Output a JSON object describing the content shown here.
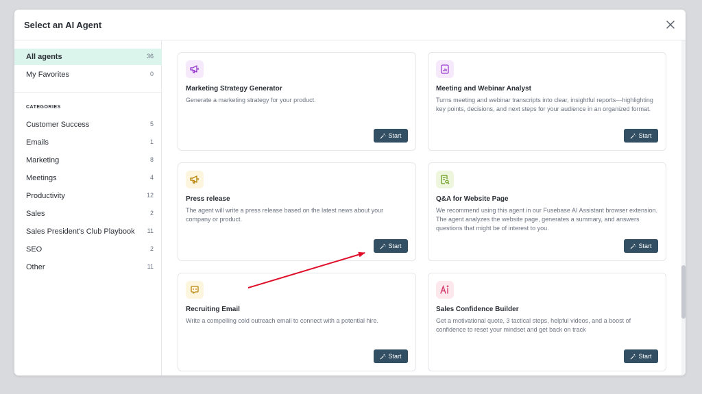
{
  "modal": {
    "title": "Select an AI Agent"
  },
  "sidebar": {
    "all": {
      "label": "All agents",
      "count": "36"
    },
    "favorites": {
      "label": "My Favorites",
      "count": "0"
    },
    "categories_heading": "CATEGORIES",
    "categories": [
      {
        "label": "Customer Success",
        "count": "5"
      },
      {
        "label": "Emails",
        "count": "1"
      },
      {
        "label": "Marketing",
        "count": "8"
      },
      {
        "label": "Meetings",
        "count": "4"
      },
      {
        "label": "Productivity",
        "count": "12"
      },
      {
        "label": "Sales",
        "count": "2"
      },
      {
        "label": "Sales President's Club Playbook",
        "count": "11"
      },
      {
        "label": "SEO",
        "count": "2"
      },
      {
        "label": "Other",
        "count": "11"
      }
    ]
  },
  "start_label": "Start",
  "cards": [
    {
      "title": "Marketing Strategy Generator",
      "desc": "Generate a marketing strategy for your product.",
      "icon": "megaphone-icon",
      "color": "#9b3fcf",
      "bg": "#f5e9fb"
    },
    {
      "title": "Meeting and Webinar Analyst",
      "desc": "Turns meeting and webinar transcripts into clear, insightful reports—highlighting key points, decisions, and next steps for your audience in an organized format.",
      "icon": "report-chart-icon",
      "color": "#9b3fcf",
      "bg": "#f5e9fb"
    },
    {
      "title": "Press release",
      "desc": "The agent will write a press release based on the latest news about your company or product.",
      "icon": "megaphone-icon",
      "color": "#b8860b",
      "bg": "#fdf5dd"
    },
    {
      "title": "Q&A for Website Page",
      "desc": "We recommend using this agent in our Fusebase AI Assistant browser extension. The agent analyzes the website page, generates a summary, and answers questions that might be of interest to you.",
      "icon": "document-search-icon",
      "color": "#6a9a1f",
      "bg": "#eef7de"
    },
    {
      "title": "Recruiting Email",
      "desc": "Write a compelling cold outreach email to connect with a potential hire.",
      "icon": "chat-sparkle-icon",
      "color": "#b8860b",
      "bg": "#fdf5dd"
    },
    {
      "title": "Sales Confidence Builder",
      "desc": "Get a motivational quote, 3 tactical steps, helpful videos, and a boost of confidence to reset your mindset and get back on track",
      "icon": "ai-text-icon",
      "color": "#d23a6a",
      "bg": "#fde8ee"
    }
  ],
  "annotation_color": "#e0102b"
}
